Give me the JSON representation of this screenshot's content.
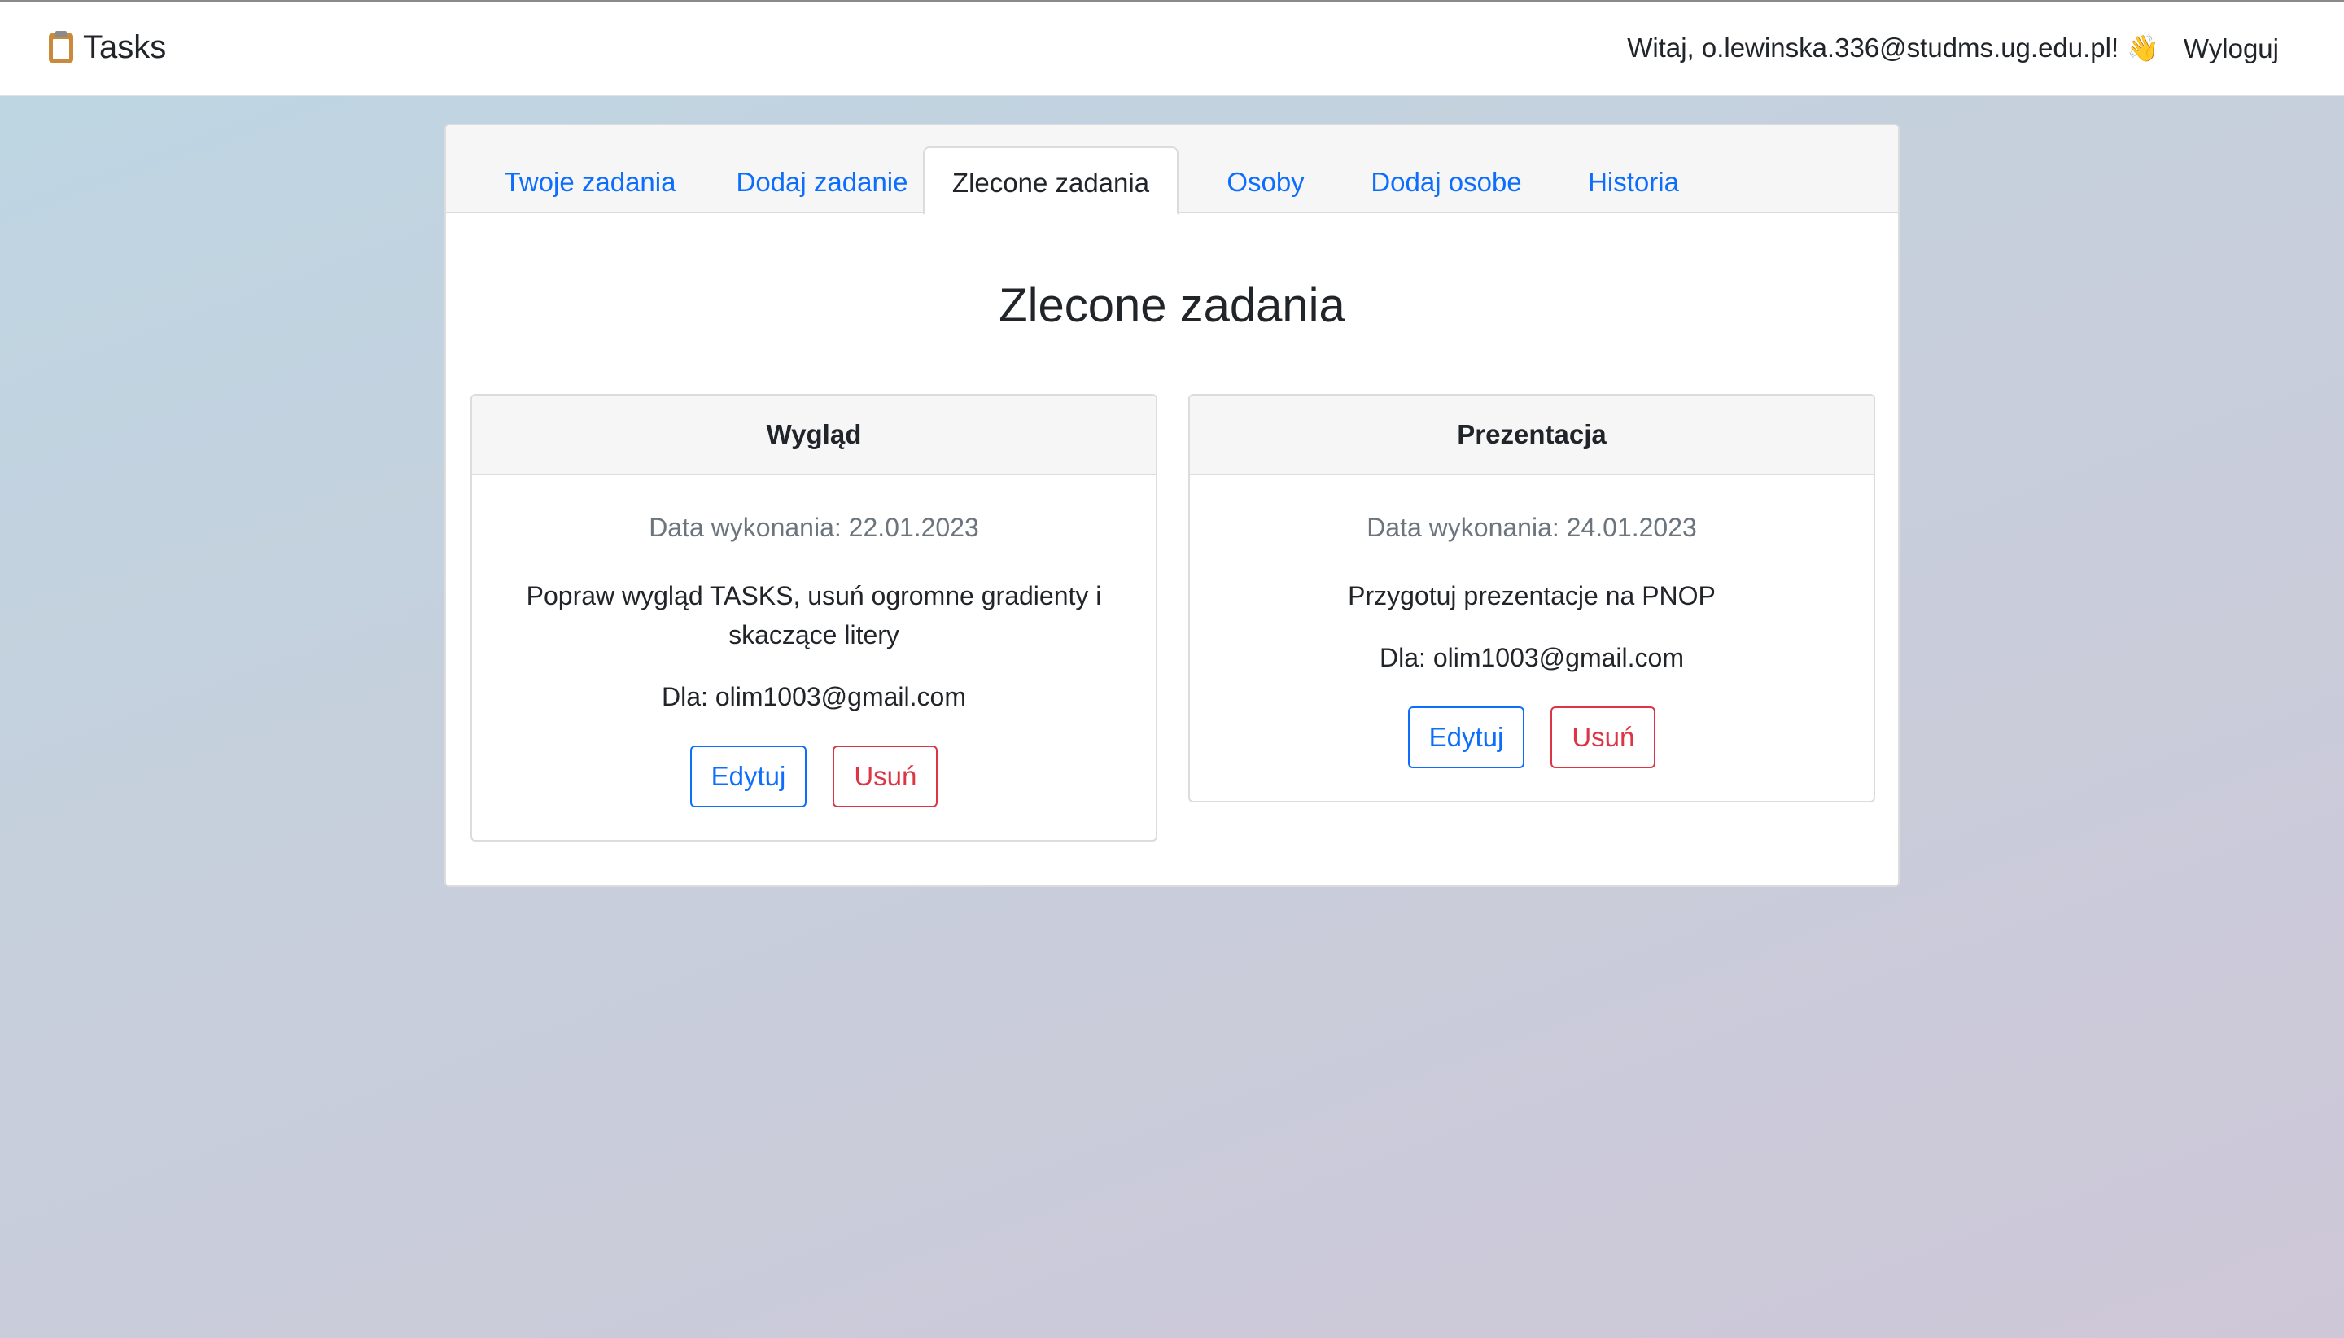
{
  "header": {
    "brand": "Tasks",
    "brand_icon": "clipboard-icon",
    "greeting": "Witaj, o.lewinska.336@studms.ug.edu.pl!",
    "greeting_icon": "waving-hand-icon",
    "logout_label": "Wyloguj"
  },
  "tabs": [
    {
      "label": "Twoje zadania",
      "active": false
    },
    {
      "label": "Dodaj zadanie",
      "active": false
    },
    {
      "label": "Zlecone zadania",
      "active": true
    },
    {
      "label": "Osoby",
      "active": false
    },
    {
      "label": "Dodaj osobe",
      "active": false
    },
    {
      "label": "Historia",
      "active": false
    }
  ],
  "main": {
    "title": "Zlecone zadania"
  },
  "tasks": [
    {
      "title": "Wygląd",
      "date": "Data wykonania: 22.01.2023",
      "description": "Popraw wygląd TASKS, usuń ogromne gradienty i skaczące litery",
      "assignee": "Dla: olim1003@gmail.com",
      "edit_label": "Edytuj",
      "delete_label": "Usuń"
    },
    {
      "title": "Prezentacja",
      "date": "Data wykonania: 24.01.2023",
      "description": "Przygotuj prezentacje na PNOP",
      "assignee": "Dla: olim1003@gmail.com",
      "edit_label": "Edytuj",
      "delete_label": "Usuń"
    }
  ],
  "colors": {
    "link": "#0d6efd",
    "danger": "#dc3545",
    "muted": "#6c757d",
    "text": "#212529"
  }
}
